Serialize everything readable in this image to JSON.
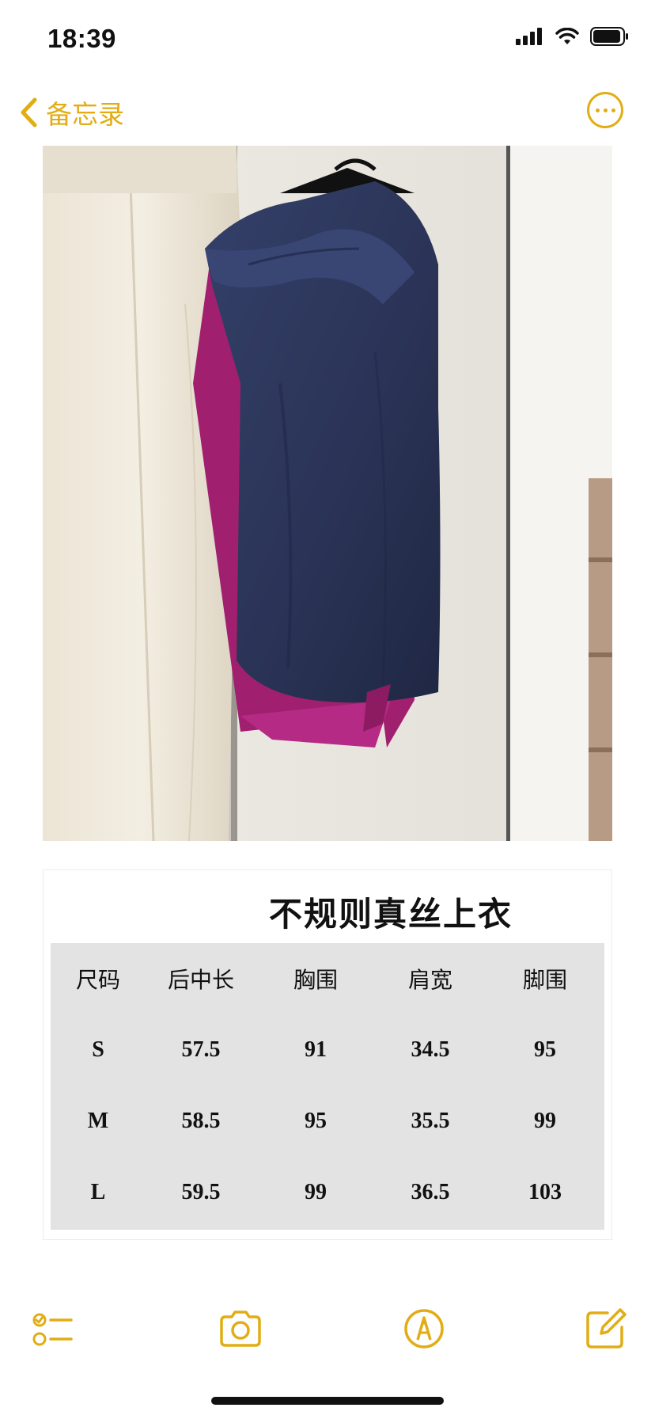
{
  "status_bar": {
    "time": "18:39"
  },
  "nav": {
    "back_label": "备忘录"
  },
  "size_chart": {
    "title": "不规则真丝上衣",
    "headers": [
      "尺码",
      "后中长",
      "胸围",
      "肩宽",
      "脚围"
    ],
    "rows": [
      [
        "S",
        "57.5",
        "91",
        "34.5",
        "95"
      ],
      [
        "M",
        "58.5",
        "95",
        "35.5",
        "99"
      ],
      [
        "L",
        "59.5",
        "99",
        "36.5",
        "103"
      ]
    ]
  },
  "colors": {
    "accent": "#e2ad14",
    "table_bg": "#e3e3e3",
    "top_navy": "#2b3558",
    "lining_magenta": "#a0206f"
  },
  "icons": {
    "back": "chevron-left-icon",
    "more": "ellipsis-circle-icon",
    "checklist": "checklist-icon",
    "camera": "camera-icon",
    "markup": "pen-circle-icon",
    "compose": "compose-icon"
  }
}
